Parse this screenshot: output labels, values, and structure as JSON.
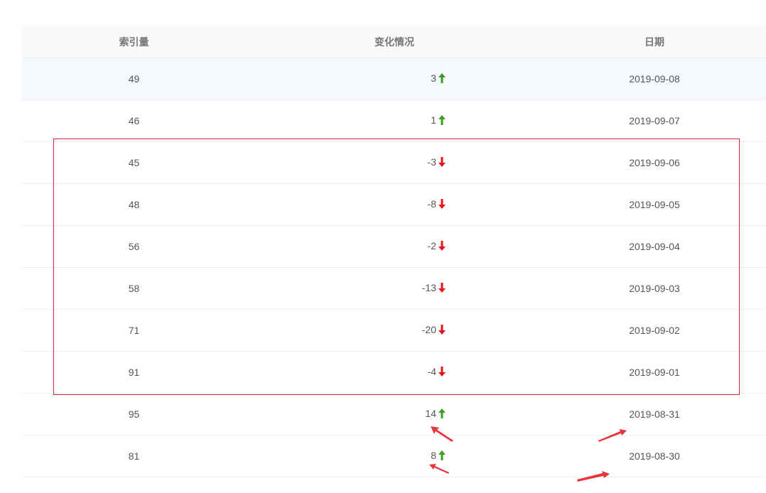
{
  "table": {
    "headers": {
      "index": "索引量",
      "change": "变化情况",
      "date": "日期"
    },
    "rows": [
      {
        "index": "49",
        "change": "3",
        "direction": "up-arrow-icon",
        "date": "2019-09-08"
      },
      {
        "index": "46",
        "change": "1",
        "direction": "up-arrow-icon",
        "date": "2019-09-07"
      },
      {
        "index": "45",
        "change": "-3",
        "direction": "down-arrow-icon",
        "date": "2019-09-06"
      },
      {
        "index": "48",
        "change": "-8",
        "direction": "down-arrow-icon",
        "date": "2019-09-05"
      },
      {
        "index": "56",
        "change": "-2",
        "direction": "down-arrow-icon",
        "date": "2019-09-04"
      },
      {
        "index": "58",
        "change": "-13",
        "direction": "down-arrow-icon",
        "date": "2019-09-03"
      },
      {
        "index": "71",
        "change": "-20",
        "direction": "down-arrow-icon",
        "date": "2019-09-02"
      },
      {
        "index": "91",
        "change": "-4",
        "direction": "down-arrow-icon",
        "date": "2019-09-01"
      },
      {
        "index": "95",
        "change": "14",
        "direction": "up-arrow-icon",
        "date": "2019-08-31"
      },
      {
        "index": "81",
        "change": "8",
        "direction": "up-arrow-icon",
        "date": "2019-08-30"
      }
    ]
  },
  "colors": {
    "up": "#3a9d23",
    "down": "#e8141a",
    "annotation": "#e8343a"
  }
}
